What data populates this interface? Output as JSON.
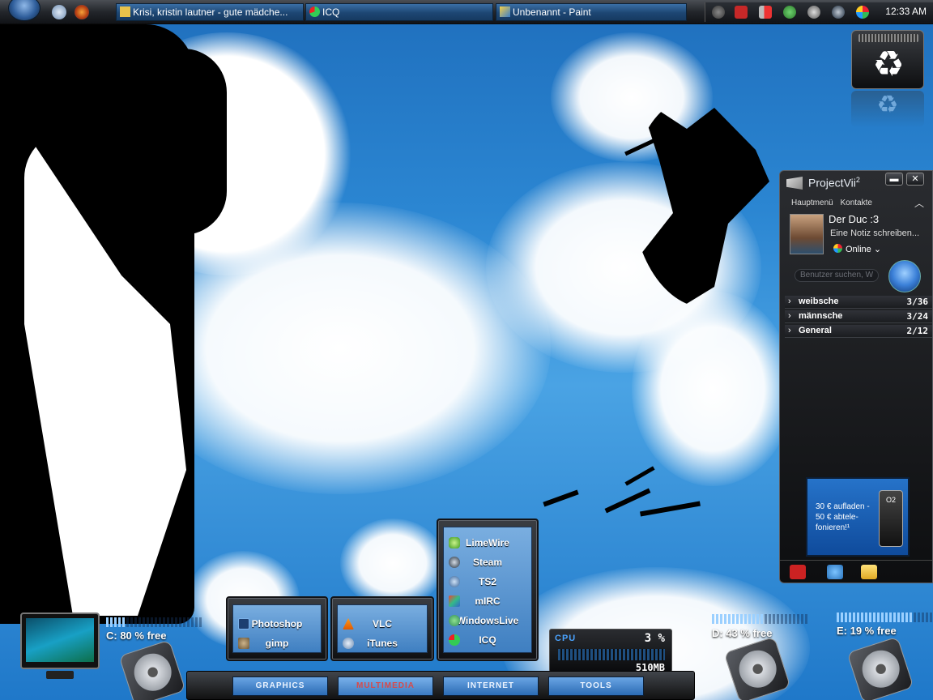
{
  "taskbar": {
    "tasks": [
      {
        "label": "Krisi, kristin lautner - gute mädche..."
      },
      {
        "label": "ICQ"
      },
      {
        "label": "Unbenannt - Paint"
      }
    ],
    "clock": "12:33 AM",
    "colors": {
      "bar": "#23262b",
      "task": "#1d4673"
    }
  },
  "icq": {
    "brand": "ProjectVii",
    "brand_sup": "2",
    "menu": [
      "Hauptmenü",
      "Kontakte"
    ],
    "user": {
      "name": "Der Duc :3",
      "note": "Eine Notiz schreiben...",
      "status": "Online"
    },
    "search_placeholder": "Benutzer suchen, W",
    "groups": [
      {
        "name": "weibsche",
        "count": "3/36"
      },
      {
        "name": "männsche",
        "count": "3/24"
      },
      {
        "name": "General",
        "count": "2/12"
      }
    ],
    "ad": {
      "text": "30 € aufladen - 50 € abtele-fonieren!¹",
      "brand": "O2"
    }
  },
  "launcher": {
    "graphics": [
      {
        "label": "Photoshop",
        "icon": "photoshop-icon"
      },
      {
        "label": "gimp",
        "icon": "gimp-icon"
      }
    ],
    "multimedia": [
      {
        "label": "VLC",
        "icon": "vlc-icon"
      },
      {
        "label": "iTunes",
        "icon": "itunes-icon"
      }
    ],
    "internet": [
      {
        "label": "LimeWire",
        "icon": "limewire-icon"
      },
      {
        "label": "Steam",
        "icon": "steam-icon"
      },
      {
        "label": "TS2",
        "icon": "teamspeak-icon"
      },
      {
        "label": "mIRC",
        "icon": "mirc-icon"
      },
      {
        "label": "WindowsLive",
        "icon": "windowslive-icon"
      },
      {
        "label": "ICQ",
        "icon": "icq-icon"
      }
    ],
    "tabs": [
      {
        "label": "GRAPHICS"
      },
      {
        "label": "MULTIMEDIA"
      },
      {
        "label": "INTERNET"
      },
      {
        "label": "TOOLS"
      }
    ]
  },
  "drives": {
    "c": {
      "label": "C: 80 % free",
      "free": 0.8
    },
    "d": {
      "label": "D: 43 % free",
      "free": 0.43
    },
    "e": {
      "label": "E: 19 % free",
      "free": 0.19
    }
  },
  "cpu": {
    "label": "CPU",
    "value": "3 %",
    "memory": "510MB"
  }
}
